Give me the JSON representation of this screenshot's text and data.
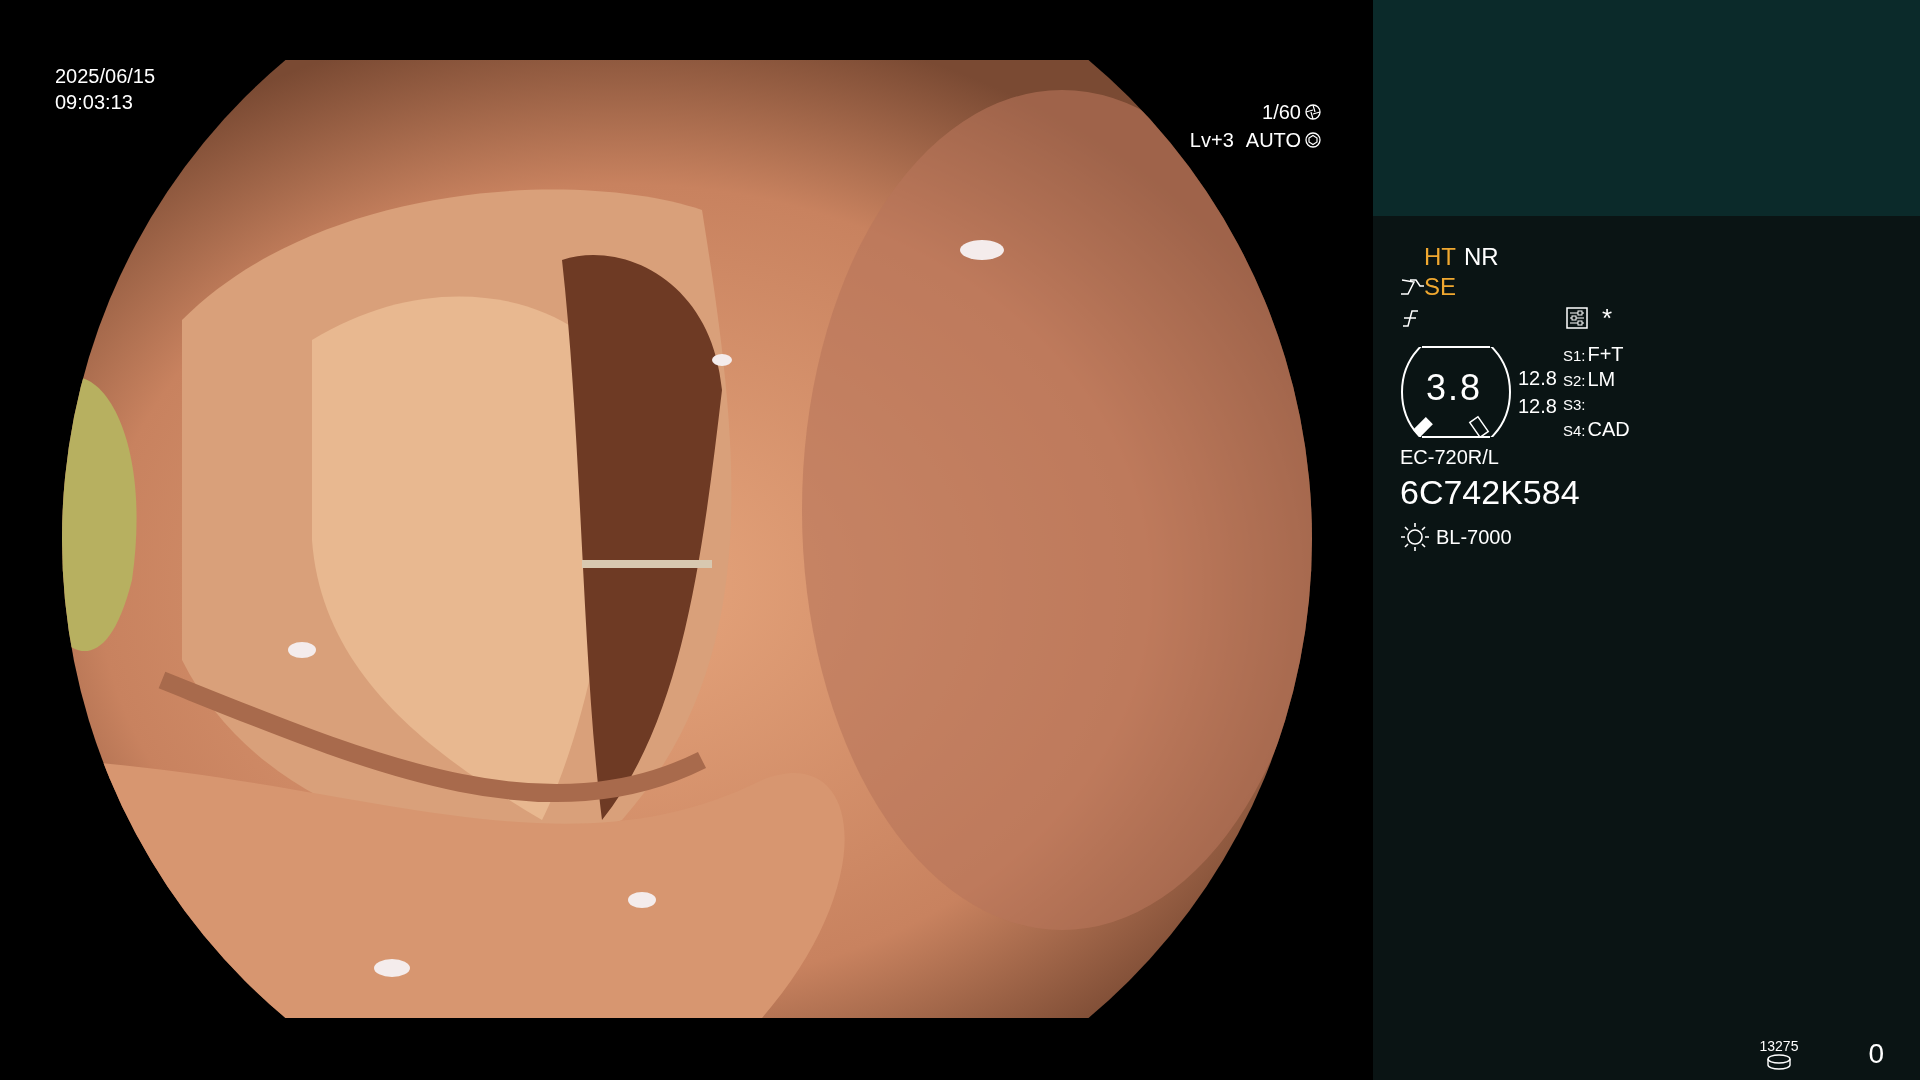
{
  "video": {
    "date": "2025/06/15",
    "time": "09:03:13",
    "shutter": "1/60",
    "level": "Lv+3",
    "iris": "AUTO"
  },
  "panel": {
    "modes": [
      {
        "label": "HT",
        "active": true
      },
      {
        "label": "NR",
        "active": false
      }
    ],
    "enhance": {
      "label": "SE",
      "active": true
    },
    "marker": "*",
    "zoom": "3.8",
    "readings": [
      "12.8",
      "12.8"
    ],
    "switches": [
      {
        "key": "S1:",
        "value": "F+T"
      },
      {
        "key": "S2:",
        "value": "LM"
      },
      {
        "key": "S3:"
      },
      {
        "key": "S4:",
        "value": "CAD"
      }
    ],
    "scope_model": "EC-720R/L",
    "scope_serial": "6C742K584",
    "light_source": "BL-7000",
    "storage_count": "13275",
    "counter": "0"
  }
}
